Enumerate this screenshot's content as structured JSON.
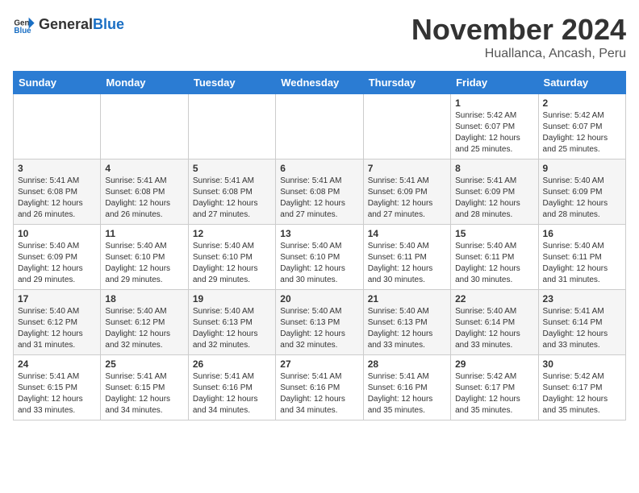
{
  "header": {
    "logo_general": "General",
    "logo_blue": "Blue",
    "month_title": "November 2024",
    "location": "Huallanca, Ancash, Peru"
  },
  "days_of_week": [
    "Sunday",
    "Monday",
    "Tuesday",
    "Wednesday",
    "Thursday",
    "Friday",
    "Saturday"
  ],
  "weeks": [
    [
      {
        "day": "",
        "info": ""
      },
      {
        "day": "",
        "info": ""
      },
      {
        "day": "",
        "info": ""
      },
      {
        "day": "",
        "info": ""
      },
      {
        "day": "",
        "info": ""
      },
      {
        "day": "1",
        "info": "Sunrise: 5:42 AM\nSunset: 6:07 PM\nDaylight: 12 hours and 25 minutes."
      },
      {
        "day": "2",
        "info": "Sunrise: 5:42 AM\nSunset: 6:07 PM\nDaylight: 12 hours and 25 minutes."
      }
    ],
    [
      {
        "day": "3",
        "info": "Sunrise: 5:41 AM\nSunset: 6:08 PM\nDaylight: 12 hours and 26 minutes."
      },
      {
        "day": "4",
        "info": "Sunrise: 5:41 AM\nSunset: 6:08 PM\nDaylight: 12 hours and 26 minutes."
      },
      {
        "day": "5",
        "info": "Sunrise: 5:41 AM\nSunset: 6:08 PM\nDaylight: 12 hours and 27 minutes."
      },
      {
        "day": "6",
        "info": "Sunrise: 5:41 AM\nSunset: 6:08 PM\nDaylight: 12 hours and 27 minutes."
      },
      {
        "day": "7",
        "info": "Sunrise: 5:41 AM\nSunset: 6:09 PM\nDaylight: 12 hours and 27 minutes."
      },
      {
        "day": "8",
        "info": "Sunrise: 5:41 AM\nSunset: 6:09 PM\nDaylight: 12 hours and 28 minutes."
      },
      {
        "day": "9",
        "info": "Sunrise: 5:40 AM\nSunset: 6:09 PM\nDaylight: 12 hours and 28 minutes."
      }
    ],
    [
      {
        "day": "10",
        "info": "Sunrise: 5:40 AM\nSunset: 6:09 PM\nDaylight: 12 hours and 29 minutes."
      },
      {
        "day": "11",
        "info": "Sunrise: 5:40 AM\nSunset: 6:10 PM\nDaylight: 12 hours and 29 minutes."
      },
      {
        "day": "12",
        "info": "Sunrise: 5:40 AM\nSunset: 6:10 PM\nDaylight: 12 hours and 29 minutes."
      },
      {
        "day": "13",
        "info": "Sunrise: 5:40 AM\nSunset: 6:10 PM\nDaylight: 12 hours and 30 minutes."
      },
      {
        "day": "14",
        "info": "Sunrise: 5:40 AM\nSunset: 6:11 PM\nDaylight: 12 hours and 30 minutes."
      },
      {
        "day": "15",
        "info": "Sunrise: 5:40 AM\nSunset: 6:11 PM\nDaylight: 12 hours and 30 minutes."
      },
      {
        "day": "16",
        "info": "Sunrise: 5:40 AM\nSunset: 6:11 PM\nDaylight: 12 hours and 31 minutes."
      }
    ],
    [
      {
        "day": "17",
        "info": "Sunrise: 5:40 AM\nSunset: 6:12 PM\nDaylight: 12 hours and 31 minutes."
      },
      {
        "day": "18",
        "info": "Sunrise: 5:40 AM\nSunset: 6:12 PM\nDaylight: 12 hours and 32 minutes."
      },
      {
        "day": "19",
        "info": "Sunrise: 5:40 AM\nSunset: 6:13 PM\nDaylight: 12 hours and 32 minutes."
      },
      {
        "day": "20",
        "info": "Sunrise: 5:40 AM\nSunset: 6:13 PM\nDaylight: 12 hours and 32 minutes."
      },
      {
        "day": "21",
        "info": "Sunrise: 5:40 AM\nSunset: 6:13 PM\nDaylight: 12 hours and 33 minutes."
      },
      {
        "day": "22",
        "info": "Sunrise: 5:40 AM\nSunset: 6:14 PM\nDaylight: 12 hours and 33 minutes."
      },
      {
        "day": "23",
        "info": "Sunrise: 5:41 AM\nSunset: 6:14 PM\nDaylight: 12 hours and 33 minutes."
      }
    ],
    [
      {
        "day": "24",
        "info": "Sunrise: 5:41 AM\nSunset: 6:15 PM\nDaylight: 12 hours and 33 minutes."
      },
      {
        "day": "25",
        "info": "Sunrise: 5:41 AM\nSunset: 6:15 PM\nDaylight: 12 hours and 34 minutes."
      },
      {
        "day": "26",
        "info": "Sunrise: 5:41 AM\nSunset: 6:16 PM\nDaylight: 12 hours and 34 minutes."
      },
      {
        "day": "27",
        "info": "Sunrise: 5:41 AM\nSunset: 6:16 PM\nDaylight: 12 hours and 34 minutes."
      },
      {
        "day": "28",
        "info": "Sunrise: 5:41 AM\nSunset: 6:16 PM\nDaylight: 12 hours and 35 minutes."
      },
      {
        "day": "29",
        "info": "Sunrise: 5:42 AM\nSunset: 6:17 PM\nDaylight: 12 hours and 35 minutes."
      },
      {
        "day": "30",
        "info": "Sunrise: 5:42 AM\nSunset: 6:17 PM\nDaylight: 12 hours and 35 minutes."
      }
    ]
  ]
}
